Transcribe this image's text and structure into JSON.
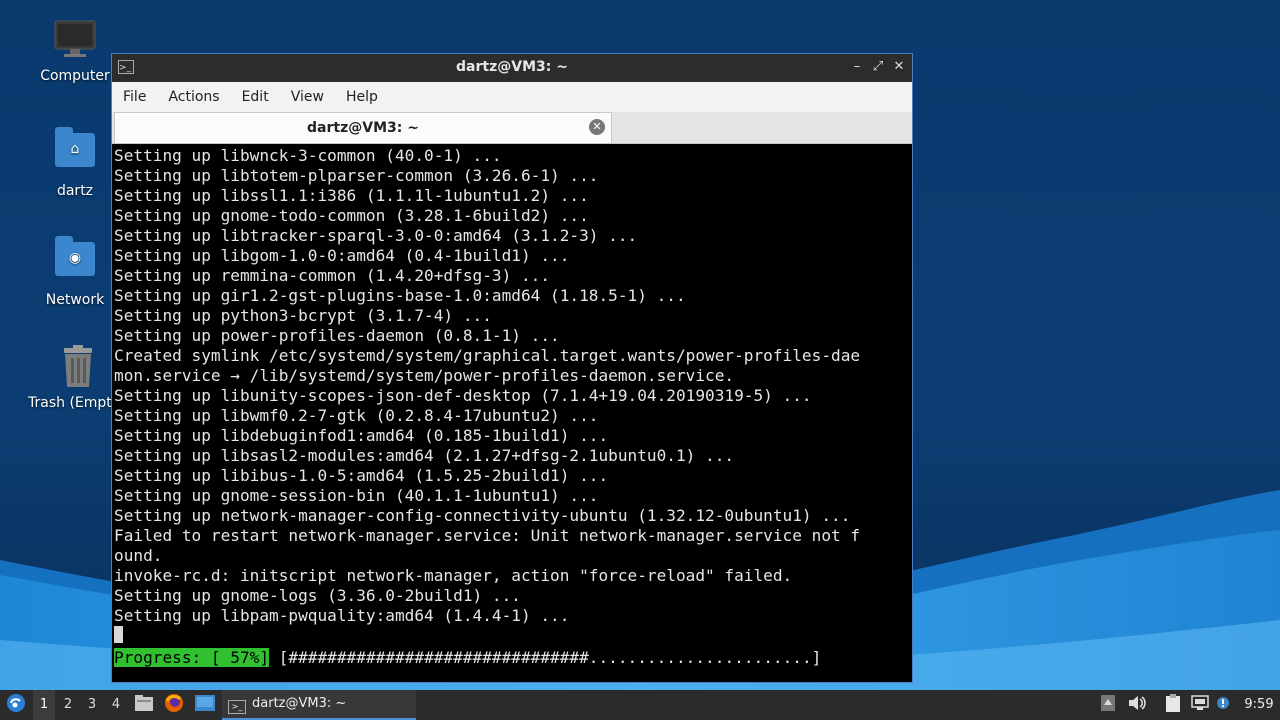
{
  "desktop": {
    "icons": [
      {
        "label": "Computer"
      },
      {
        "label": "dartz"
      },
      {
        "label": "Network"
      },
      {
        "label": "Trash (Empt"
      }
    ]
  },
  "window": {
    "title": "dartz@VM3: ~",
    "menu": [
      "File",
      "Actions",
      "Edit",
      "View",
      "Help"
    ],
    "tab_label": "dartz@VM3: ~"
  },
  "terminal": {
    "lines": [
      "Setting up libwnck-3-common (40.0-1) ...",
      "Setting up libtotem-plparser-common (3.26.6-1) ...",
      "Setting up libssl1.1:i386 (1.1.1l-1ubuntu1.2) ...",
      "Setting up gnome-todo-common (3.28.1-6build2) ...",
      "Setting up libtracker-sparql-3.0-0:amd64 (3.1.2-3) ...",
      "Setting up libgom-1.0-0:amd64 (0.4-1build1) ...",
      "Setting up remmina-common (1.4.20+dfsg-3) ...",
      "Setting up gir1.2-gst-plugins-base-1.0:amd64 (1.18.5-1) ...",
      "Setting up python3-bcrypt (3.1.7-4) ...",
      "Setting up power-profiles-daemon (0.8.1-1) ...",
      "Created symlink /etc/systemd/system/graphical.target.wants/power-profiles-dae",
      "mon.service → /lib/systemd/system/power-profiles-daemon.service.",
      "Setting up libunity-scopes-json-def-desktop (7.1.4+19.04.20190319-5) ...",
      "Setting up libwmf0.2-7-gtk (0.2.8.4-17ubuntu2) ...",
      "Setting up libdebuginfod1:amd64 (0.185-1build1) ...",
      "Setting up libsasl2-modules:amd64 (2.1.27+dfsg-2.1ubuntu0.1) ...",
      "Setting up libibus-1.0-5:amd64 (1.5.25-2build1) ...",
      "Setting up gnome-session-bin (40.1.1-1ubuntu1) ...",
      "Setting up network-manager-config-connectivity-ubuntu (1.32.12-0ubuntu1) ...",
      "Failed to restart network-manager.service: Unit network-manager.service not f",
      "ound.",
      "invoke-rc.d: initscript network-manager, action \"force-reload\" failed.",
      "Setting up gnome-logs (3.36.0-2build1) ...",
      "Setting up libpam-pwquality:amd64 (1.4.4-1) ..."
    ],
    "progress_label": "Progress: [ 57%]",
    "progress_bar": "[###############################.......................]",
    "progress_percent": 57
  },
  "taskbar": {
    "workspaces": [
      "1",
      "2",
      "3",
      "4"
    ],
    "task_label": "dartz@VM3: ~",
    "clock": "9:59"
  }
}
